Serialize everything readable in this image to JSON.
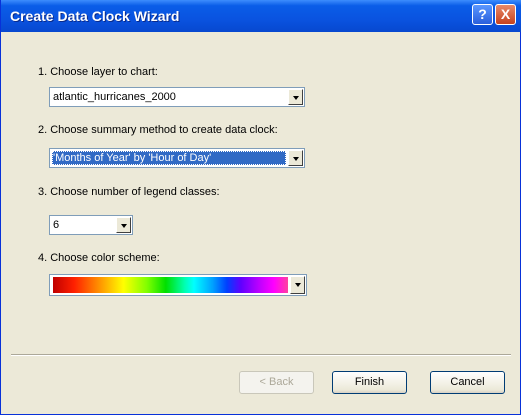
{
  "window": {
    "title": "Create Data Clock Wizard",
    "help_glyph": "?",
    "close_glyph": "X"
  },
  "steps": [
    {
      "label": "1. Choose layer to chart:",
      "value": "atlantic_hurricanes_2000"
    },
    {
      "label": "2. Choose summary method to create data clock:",
      "value": "'Months of Year' by 'Hour of Day'"
    },
    {
      "label": "3. Choose number of legend classes:",
      "value": "6"
    },
    {
      "label": "4. Choose color scheme:",
      "value": ""
    }
  ],
  "colors": {
    "title_bar": "#0a53e0",
    "selection": "#316ac5",
    "dialog_bg": "#ece9d8"
  },
  "buttons": {
    "back": "< Back",
    "finish": "Finish",
    "cancel": "Cancel"
  }
}
